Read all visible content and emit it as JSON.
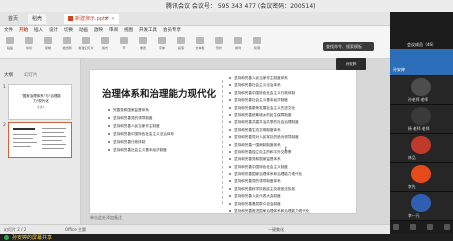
{
  "meeting": {
    "title": "腾讯会议 会议号： 595 343 477  (会议密码：200514)"
  },
  "tabs": [
    {
      "label": "首页"
    },
    {
      "label": "稻壳"
    },
    {
      "label": "新建演示.pptx"
    }
  ],
  "menus": [
    "文件",
    "开始",
    "插入",
    "设计",
    "切换",
    "动画",
    "放映",
    "审阅",
    "视图",
    "开发工具",
    "会员专享"
  ],
  "tools": [
    "粘贴",
    "剪切",
    "复制",
    "格式刷",
    "新建幻灯片",
    "版式",
    "节",
    "重置",
    "字体",
    "段落",
    "文本框",
    "形状",
    "排列",
    "轮廓"
  ],
  "ribbon_search": "查找命令、搜索模板",
  "panel": {
    "tab_outline": "大纲",
    "tab_slides": "幻灯片"
  },
  "thumbs": [
    {
      "num": "1",
      "title": "\"国家治理体系\"与\"治理能力\"现代化",
      "subtitle": "主讲人"
    },
    {
      "num": "2"
    }
  ],
  "slide": {
    "title": "治理体系和治理能力现代化",
    "left_items": [
      "完善党和国家监督体系",
      "坚持和完善党的领导制度",
      "坚持和完善人民当家作主制度",
      "坚持和完善中国特色社会主义法治体系",
      "坚持和完善行政体制",
      "坚持和完善社会主义基本经济制度"
    ],
    "right_items": [
      "坚持和完善人民当家作主制度体系",
      "坚持和完善社会主义法治体系",
      "坚持和完善中国特色社会主义行政体制",
      "坚持和完善社会主义基本经济制度",
      "坚持和完善繁荣发展社会主义先进文化",
      "坚持和完善统筹城乡的民生保障制度",
      "坚持和完善共建共治共享的社会治理制度",
      "坚持和完善生态文明制度体系",
      "坚持和完善党对人民军队的绝对领导制度",
      "坚持和完善一国两制制度体系",
      "坚持和完善独立自主的和平外交政策",
      "坚持和完善党和国家监督体系",
      "坚持和完善中国特色社会主义制度",
      "坚持和完善国家治理体系和治理能力现代化",
      "坚持和完善党的领导制度体系",
      "坚持和完善科学执政民主执政依法执政",
      "坚持和完善人民代表大会制度",
      "坚持和完善基层群众自治制度",
      "坚持和完善推进国家治理体系和治理能力现代化"
    ]
  },
  "notes": "单击此处添加备注",
  "status": {
    "left": "幻灯片 2 / 2",
    "mid": "Office 主题",
    "right": "一键美化"
  },
  "share_bar": "孙安婷的屏幕共享",
  "right_panel": {
    "header": "会议成员（46）",
    "speaker": "孙安婷",
    "participants": [
      {
        "name": "孙老师 老师"
      },
      {
        "name": "杨 老师 老师"
      },
      {
        "name": "林品"
      },
      {
        "name": "李先"
      },
      {
        "name": "李一凡"
      }
    ]
  },
  "float_card": "孙安婷"
}
